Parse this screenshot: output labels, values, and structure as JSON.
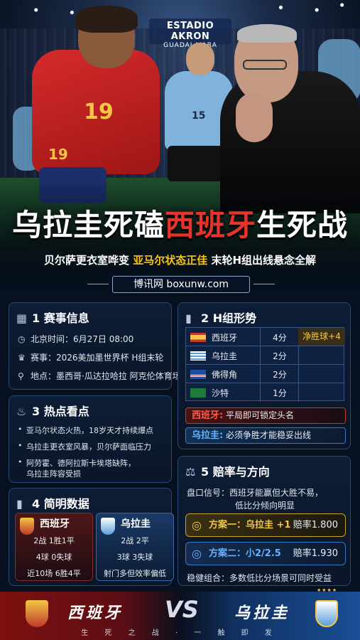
{
  "hero": {
    "stadium_name": "ESTADIO AKRON",
    "stadium_city": "GUADALAJARA",
    "spain_player_number": "19",
    "uruguay_player_number": "15",
    "headline_part1": "乌拉圭死磕",
    "headline_part2": "西班牙",
    "headline_part3": "生死战",
    "sub_part1": "贝尔萨更衣室哗变",
    "sub_part2": "亚马尔状态正佳",
    "sub_part3": "末轮H组出线悬念全解",
    "brand": "博讯网 boxunw.com"
  },
  "match_info": {
    "title": "1 赛事信息",
    "time": "北京时间：6月27日 08:00",
    "event": "赛事：2026美加墨世界杯 H组末轮",
    "venue": "地点：墨西哥·瓜达拉哈拉 阿克伦体育场"
  },
  "group": {
    "title": "2 H组形势",
    "rows": [
      {
        "team": "西班牙",
        "points": "4分",
        "note": "净胜球+4"
      },
      {
        "team": "乌拉圭",
        "points": "2分",
        "note": ""
      },
      {
        "team": "佛得角",
        "points": "2分",
        "note": ""
      },
      {
        "team": "沙特",
        "points": "1分",
        "note": ""
      }
    ],
    "spain_tag_team": "西班牙:",
    "spain_tag_text": "平局即可锁定头名",
    "uruguay_tag_team": "乌拉圭:",
    "uruguay_tag_text": "必须争胜才能稳妥出线"
  },
  "hot": {
    "title": "3 热点看点",
    "items": [
      "亚马尔状态火热，18岁天才持续爆点",
      "乌拉圭更衣室风暴，贝尔萨面临压力",
      "阿劳霍、德阿拉斯卡埃塔缺阵，",
      "乌拉圭阵容受损"
    ]
  },
  "stats": {
    "title": "4 简明数据",
    "spain": {
      "name": "西班牙",
      "r1": "2战 1胜1平",
      "r2": "4球 0失球",
      "r3": "近10场 6胜4平"
    },
    "uruguay": {
      "name": "乌拉圭",
      "r1": "2战 2平",
      "r2": "3球 3失球",
      "r3": "射门多但效率偏低"
    }
  },
  "odds": {
    "title": "5 赔率与方向",
    "signal1": "盘口信号：西班牙能赢但大胜不易，",
    "signal2": "低比分倾向明显",
    "plan1_label": "方案一：乌拉圭 +1",
    "plan1_odds": "赔率1.800",
    "plan2_label": "方案二：小2/2.5",
    "plan2_odds": "赔率1.930",
    "combo": "稳健组合：多数低比分场景可同时受益"
  },
  "banner": {
    "spain": "西班牙",
    "vs": "VS",
    "uruguay": "乌拉圭",
    "slogan": "生 死 之 战 · 一 触 即 发"
  },
  "colors": {
    "accent_red": "#e8332d",
    "accent_yellow": "#f5c518",
    "accent_blue": "#66b3ff",
    "panel_bg": "#0d1d36"
  }
}
